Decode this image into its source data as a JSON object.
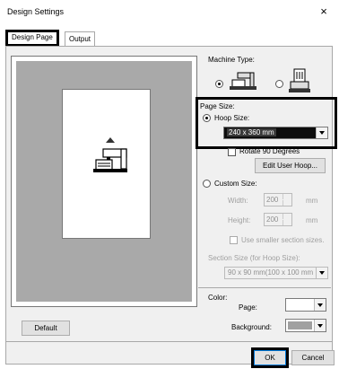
{
  "window": {
    "title": "Design Settings",
    "close_label": "×"
  },
  "tabs": [
    {
      "label": "Design Page"
    },
    {
      "label": "Output"
    }
  ],
  "machine_type": {
    "label": "Machine Type:"
  },
  "page_size": {
    "label": "Page Size:",
    "hoop_size_label": "Hoop Size:",
    "hoop_size_value": "240 x 360 mm",
    "rotate_label": "Rotate 90 Degrees",
    "edit_user_hoop_label": "Edit User Hoop...",
    "custom_size_label": "Custom Size:",
    "width_label": "Width:",
    "width_value": "200",
    "height_label": "Height:",
    "height_value": "200",
    "unit": "mm",
    "smaller_sections_label": "Use smaller section sizes.",
    "section_size_label": "Section Size (for Hoop Size):",
    "section_size_value": "90 x  90 mm(100 x 100 mm"
  },
  "color": {
    "label": "Color:",
    "page_label": "Page:",
    "page_color": "#ffffff",
    "background_label": "Background:",
    "background_color": "#a0a0a0"
  },
  "buttons": {
    "default": "Default",
    "ok": "OK",
    "cancel": "Cancel"
  }
}
